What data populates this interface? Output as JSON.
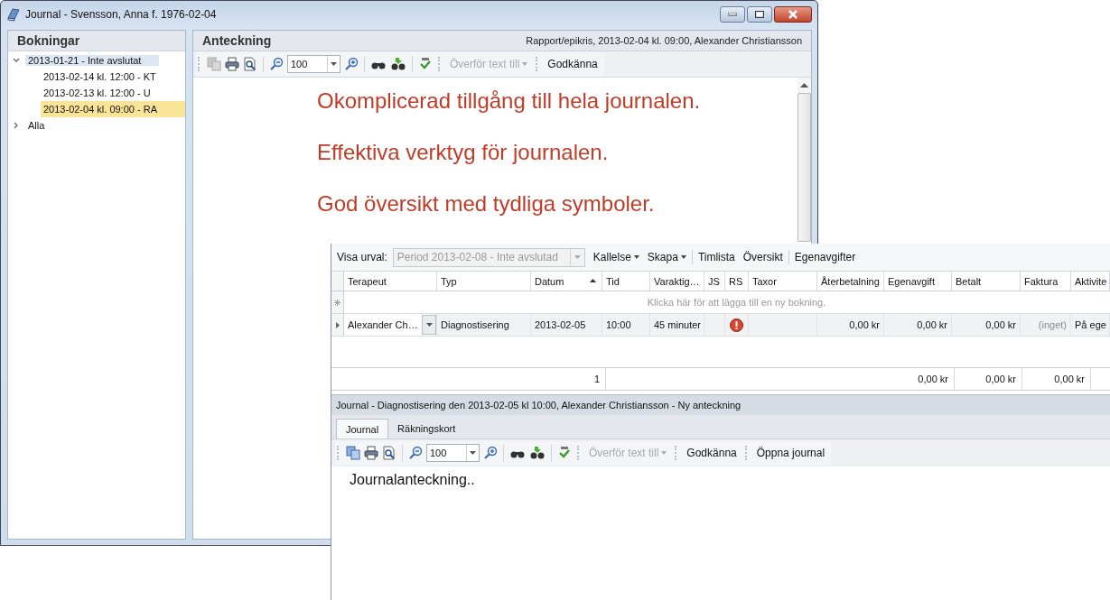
{
  "journal_window": {
    "title": "Journal - Svensson, Anna f. 1976-02-04",
    "bookings_panel": {
      "title": "Bokningar",
      "tree": [
        {
          "label": "2013-01-21 - Inte avslutat",
          "expanded": true,
          "focused": true,
          "children": [
            {
              "label": "2013-02-14 kl. 12:00 - KT",
              "selected": false
            },
            {
              "label": "2013-02-13 kl. 12:00 - U",
              "selected": false
            },
            {
              "label": "2013-02-04 kl. 09:00 - RA",
              "selected": true
            }
          ]
        },
        {
          "label": "Alla",
          "expanded": false,
          "focused": false
        }
      ]
    },
    "note_panel": {
      "title": "Anteckning",
      "subtitle": "Rapport/epikris, 2013-02-04 kl. 09:00, Alexander Christiansson",
      "toolbar": {
        "zoom": "100",
        "buttons": [
          {
            "label": "Överför text till",
            "disabled": true,
            "dropdown": true
          },
          {
            "label": "Godkänna",
            "disabled": false,
            "dropdown": false
          }
        ]
      },
      "content": [
        "Okomplicerad tillgång till hela journalen.",
        "Effektiva verktyg för journalen.",
        "God översikt med tydliga symboler."
      ]
    }
  },
  "booking_window": {
    "filter_label": "Visa urval:",
    "filter_value": "Period 2013-02-08 - Inte avslutad",
    "menu": [
      {
        "label": "Kallelse",
        "dropdown": true
      },
      {
        "label": "Skapa",
        "dropdown": true
      },
      {
        "label": "Timlista",
        "dropdown": false
      },
      {
        "label": "Översikt",
        "dropdown": false
      },
      {
        "label": "Egenavgifter",
        "dropdown": false
      }
    ],
    "columns": [
      {
        "label": "Terapeut",
        "sorted": false
      },
      {
        "label": "Typ",
        "sorted": false
      },
      {
        "label": "Datum",
        "sorted": true
      },
      {
        "label": "Tid",
        "sorted": false
      },
      {
        "label": "Varaktig…",
        "sorted": false
      },
      {
        "label": "JS",
        "sorted": false
      },
      {
        "label": "RS",
        "sorted": false
      },
      {
        "label": "Taxor",
        "sorted": false
      },
      {
        "label": "Återbetalning",
        "sorted": false
      },
      {
        "label": "Egenavgift",
        "sorted": false
      },
      {
        "label": "Betalt",
        "sorted": false
      },
      {
        "label": "Faktura",
        "sorted": false
      },
      {
        "label": "Aktivite",
        "sorted": false
      }
    ],
    "new_row_hint": "Klicka här för att lägga till en ny bokning.",
    "rows": [
      {
        "therapist": "Alexander Ch…",
        "type": "Diagnostisering",
        "date": "2013-02-05",
        "time": "10:00",
        "duration": "45 minuter",
        "rs_warning": true,
        "refund": "0,00 kr",
        "fee": "0,00 kr",
        "paid": "0,00 kr",
        "invoice": "(inget)",
        "activity": "På ege"
      }
    ],
    "summary": {
      "count": "1",
      "refund": "0,00 kr",
      "fee": "0,00 kr",
      "paid": "0,00 kr"
    },
    "journal": {
      "title": "Journal - Diagnostisering den 2013-02-05 kl 10:00, Alexander Christiansson - Ny anteckning",
      "tabs": [
        {
          "label": "Journal",
          "selected": true
        },
        {
          "label": "Räkningskort",
          "selected": false
        }
      ],
      "toolbar": {
        "zoom": "100",
        "buttons": [
          {
            "label": "Överför text till",
            "disabled": true,
            "dropdown": true
          },
          {
            "label": "Godkänna",
            "disabled": false,
            "dropdown": false
          },
          {
            "label": "Öppna journal",
            "disabled": false,
            "dropdown": false
          }
        ]
      },
      "text": "Journalanteckning.."
    }
  }
}
